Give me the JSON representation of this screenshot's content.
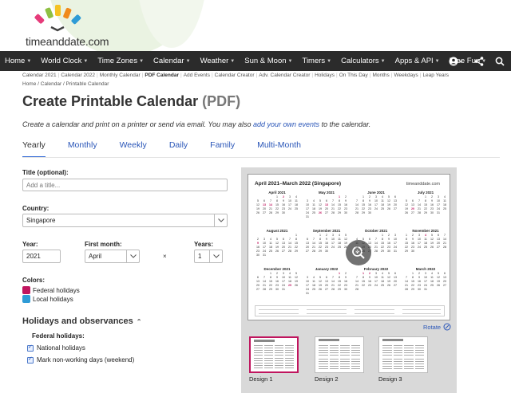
{
  "logo": {
    "text": "timeanddate.com"
  },
  "nav": {
    "items": [
      {
        "label": "Home",
        "caret": true
      },
      {
        "label": "World Clock",
        "caret": true
      },
      {
        "label": "Time Zones",
        "caret": true
      },
      {
        "label": "Calendar",
        "caret": true
      },
      {
        "label": "Weather",
        "caret": true
      },
      {
        "label": "Sun & Moon",
        "caret": true
      },
      {
        "label": "Timers",
        "caret": true
      },
      {
        "label": "Calculators",
        "caret": true
      },
      {
        "label": "Apps & API",
        "caret": true
      },
      {
        "label": "Free Fun",
        "caret": true
      }
    ],
    "icons": [
      "account-icon",
      "share-icon",
      "search-icon"
    ]
  },
  "subnav": [
    "Calendar 2021",
    "Calendar 2022",
    "Monthly Calendar",
    "PDF Calendar",
    "Add Events",
    "Calendar Creator",
    "Adv. Calendar Creator",
    "Holidays",
    "On This Day",
    "Months",
    "Weekdays",
    "Leap Years"
  ],
  "subnav_active": "PDF Calendar",
  "breadcrumb": "Home /  Calendar /  Printable Calendar",
  "page": {
    "title": "Create Printable Calendar",
    "title_suffix": "(PDF)",
    "intro_before": "Create a calendar and print on a printer or send via email. You may also ",
    "intro_link": "add your own events",
    "intro_after": " to the calendar."
  },
  "tabs": [
    {
      "label": "Yearly",
      "active": true
    },
    {
      "label": "Monthly",
      "active": false
    },
    {
      "label": "Weekly",
      "active": false
    },
    {
      "label": "Daily",
      "active": false
    },
    {
      "label": "Family",
      "active": false
    },
    {
      "label": "Multi-Month",
      "active": false
    }
  ],
  "form": {
    "title_label": "Title (optional):",
    "title_placeholder": "Add a title...",
    "country_label": "Country:",
    "country_value": "Singapore",
    "year_label": "Year:",
    "year_value": "2021",
    "first_month_label": "First month:",
    "first_month_value": "April",
    "times": "×",
    "years_label": "Years:",
    "years_value": "1",
    "colors_label": "Colors:",
    "colors": [
      {
        "label": "Federal holidays",
        "color": "#c0155e"
      },
      {
        "label": "Local holidays",
        "color": "#2e9bd6"
      }
    ]
  },
  "holidays": {
    "heading": "Holidays and observances",
    "sub_heading": "Federal holidays:",
    "checks": [
      {
        "label": "National holidays",
        "checked": true
      },
      {
        "label": "Mark non-working days (weekend)",
        "checked": true
      }
    ]
  },
  "preview": {
    "sheet_title": "April 2021–March 2022 (Singapore)",
    "sheet_logo": "timeanddate.com",
    "months": [
      {
        "name": "April 2021",
        "start": 3,
        "days": 30,
        "hol": [
          2,
          13,
          14
        ]
      },
      {
        "name": "May 2021",
        "start": 5,
        "days": 31,
        "hol": [
          1,
          13,
          26
        ]
      },
      {
        "name": "June 2021",
        "start": 1,
        "days": 30,
        "hol": []
      },
      {
        "name": "July 2021",
        "start": 3,
        "days": 31,
        "hol": [
          20
        ]
      },
      {
        "name": "August 2021",
        "start": 6,
        "days": 31,
        "hol": [
          9
        ]
      },
      {
        "name": "September 2021",
        "start": 2,
        "days": 30,
        "hol": []
      },
      {
        "name": "October 2021",
        "start": 4,
        "days": 31,
        "hol": []
      },
      {
        "name": "November 2021",
        "start": 0,
        "days": 30,
        "hol": [
          4
        ]
      },
      {
        "name": "December 2021",
        "start": 2,
        "days": 31,
        "hol": [
          25
        ]
      },
      {
        "name": "January 2022",
        "start": 5,
        "days": 31,
        "hol": [
          1
        ]
      },
      {
        "name": "February 2022",
        "start": 1,
        "days": 28,
        "hol": [
          1,
          2
        ]
      },
      {
        "name": "March 2022",
        "start": 1,
        "days": 31,
        "hol": []
      }
    ],
    "rotate_label": "Rotate",
    "designs": [
      "Design 1",
      "Design 2",
      "Design 3"
    ]
  }
}
